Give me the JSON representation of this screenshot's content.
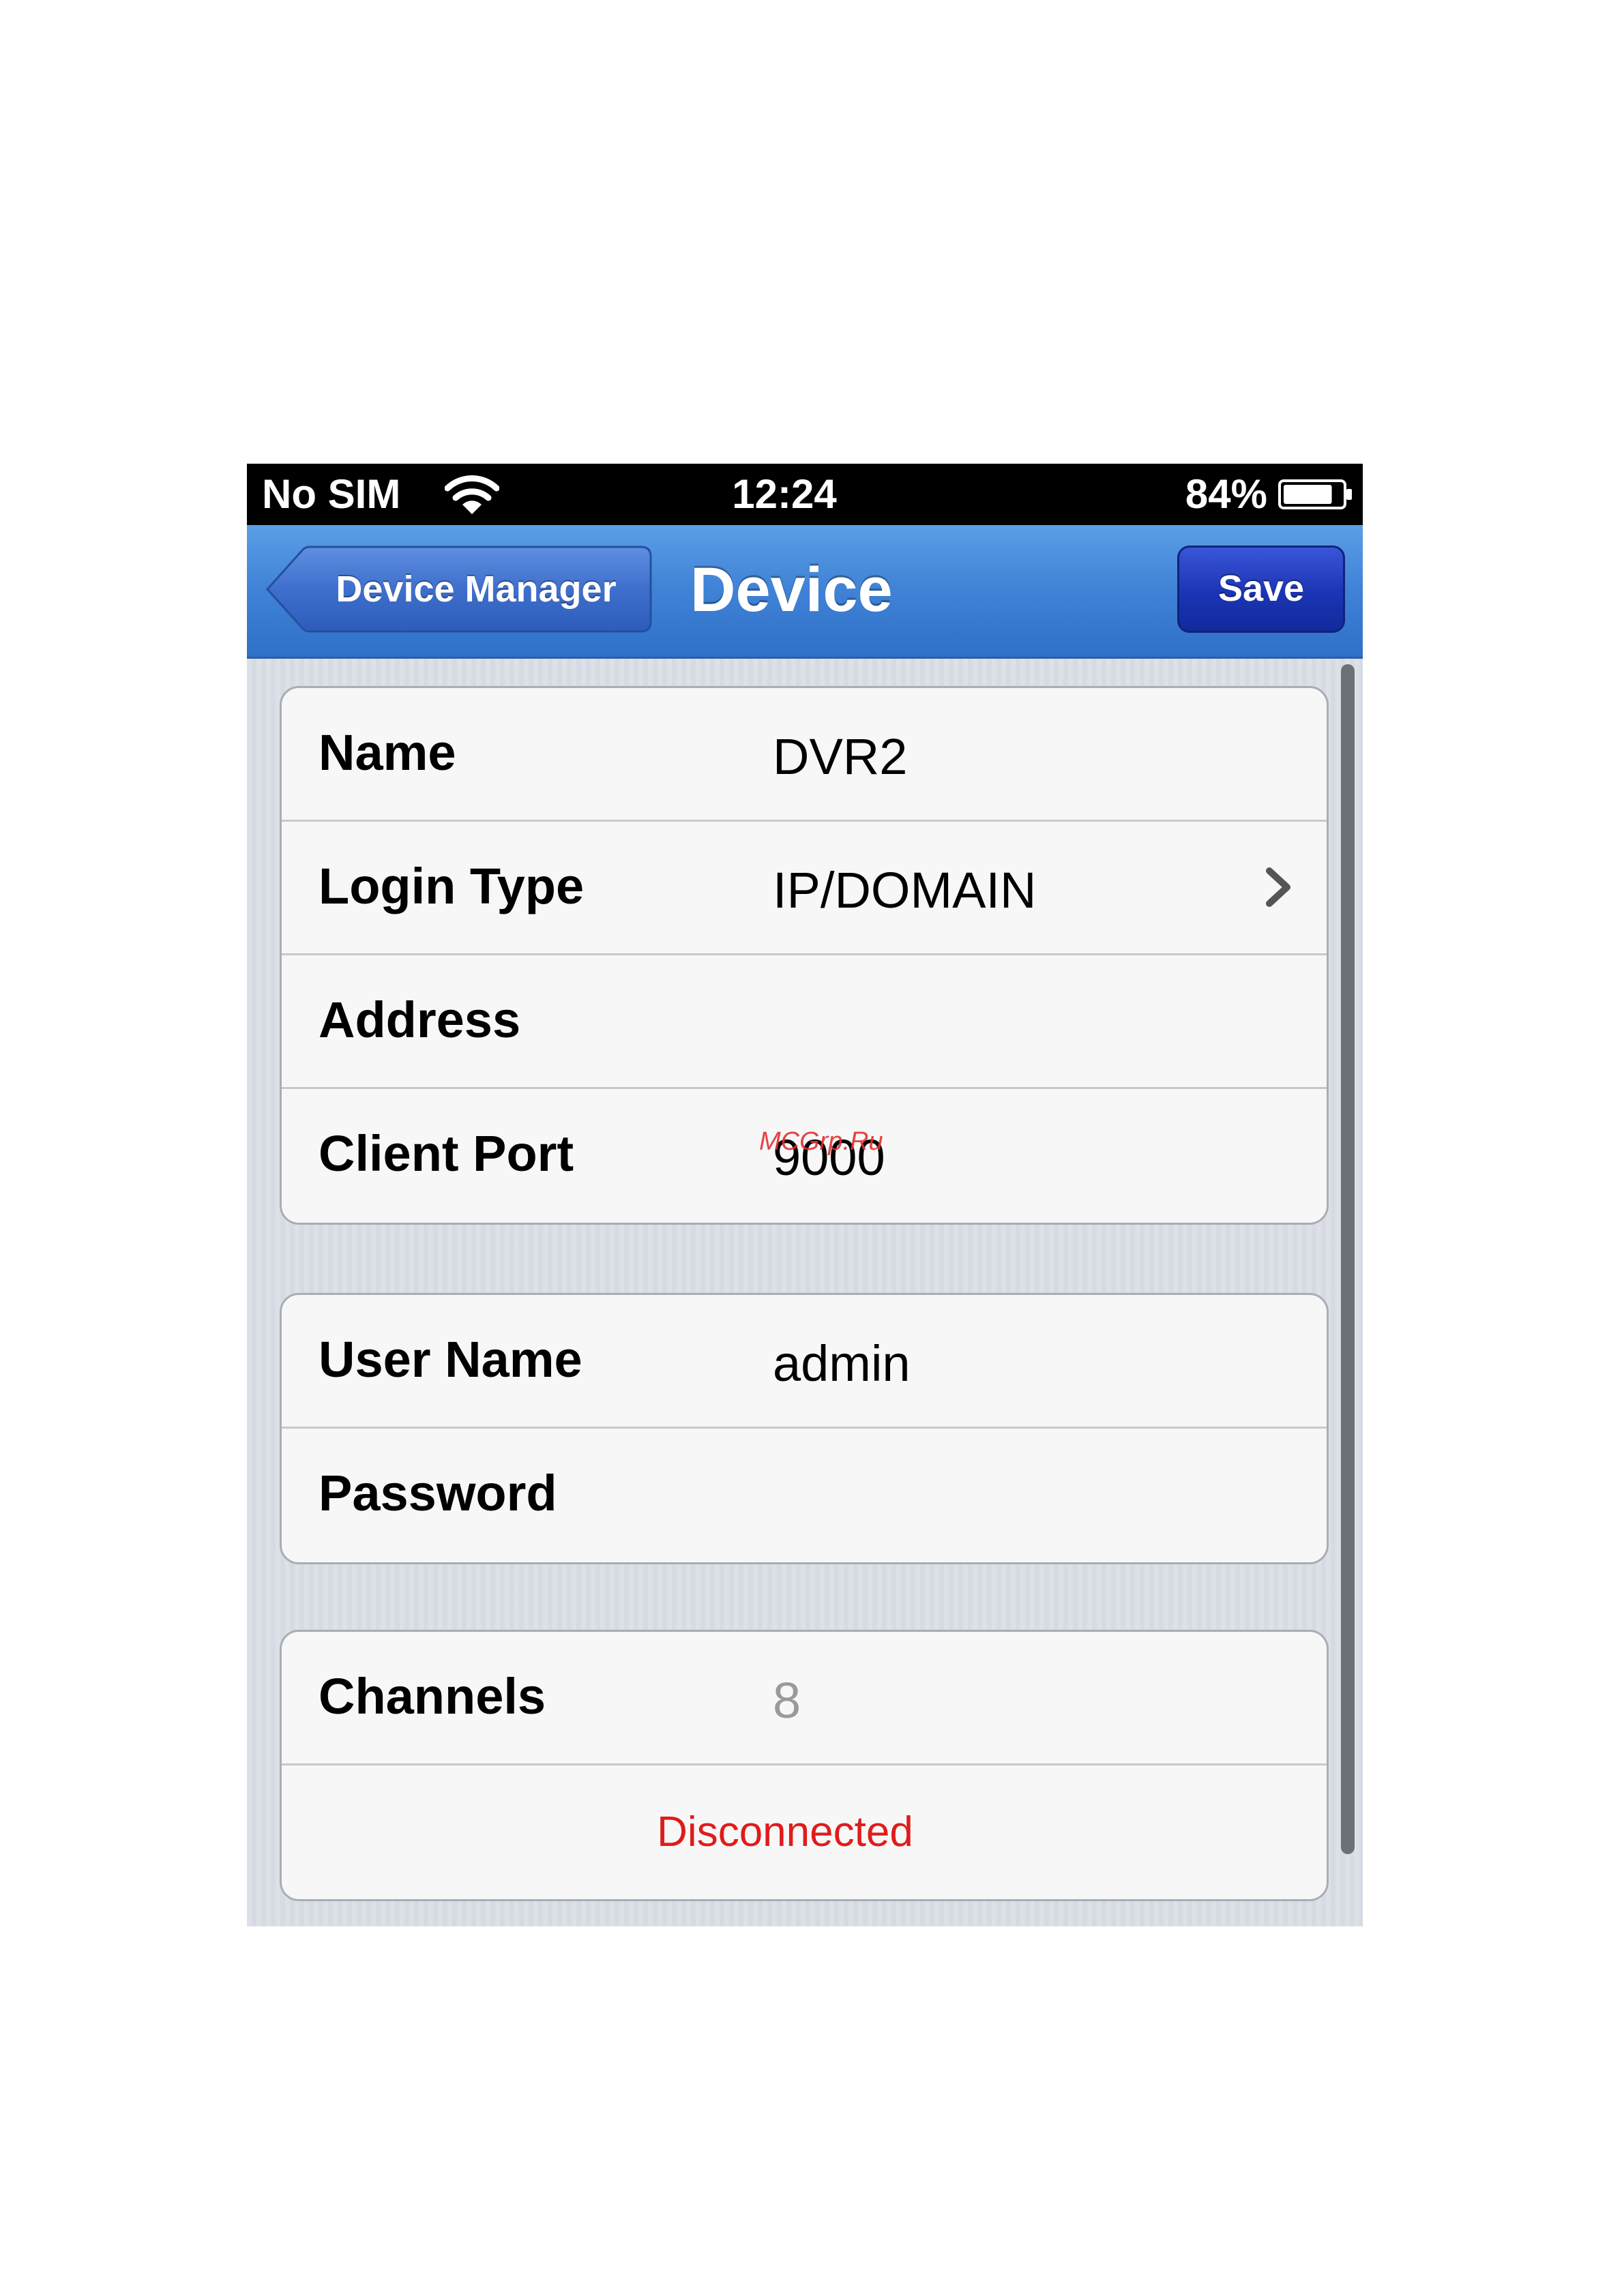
{
  "status_bar": {
    "carrier": "No SIM",
    "time": "12:24",
    "battery_percent": "84%",
    "battery_level": 0.84
  },
  "nav": {
    "back_label": "Device Manager",
    "title": "Device",
    "save_label": "Save"
  },
  "groups": [
    {
      "rows": [
        {
          "label": "Name",
          "value": "DVR2"
        },
        {
          "label": "Login Type",
          "value": "IP/DOMAIN"
        },
        {
          "label": "Address",
          "value": ""
        },
        {
          "label": "Client Port",
          "value": "9000"
        }
      ]
    },
    {
      "rows": [
        {
          "label": "User Name",
          "value": "admin"
        },
        {
          "label": "Password",
          "value": ""
        }
      ]
    },
    {
      "rows": [
        {
          "label": "Channels",
          "value": "8"
        },
        {
          "status": "Disconnected"
        }
      ]
    }
  ],
  "watermark": "MCGrp.Ru",
  "colors": {
    "nav_blue": "#3f82d6",
    "save_blue": "#1b34b4",
    "status_red": "#e01b1b"
  }
}
